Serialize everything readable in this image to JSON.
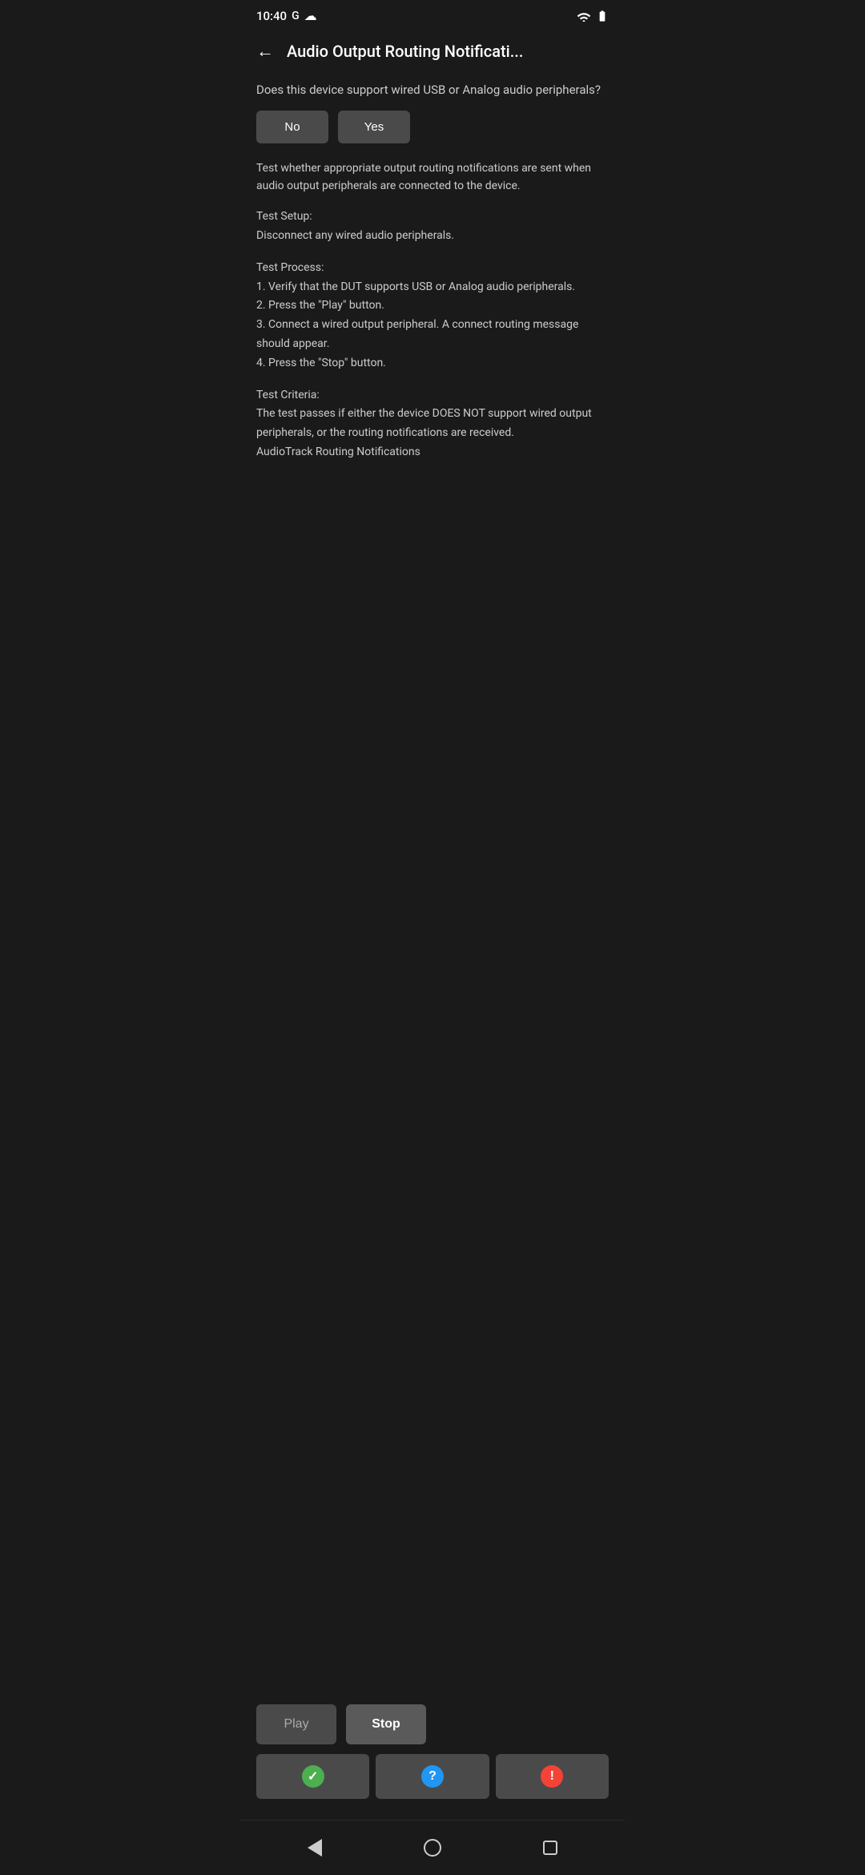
{
  "statusBar": {
    "time": "10:40",
    "googleIcon": "G",
    "cloudIcon": "☁",
    "wifiIcon": "▾",
    "batteryIcon": "🔋"
  },
  "header": {
    "backLabel": "←",
    "title": "Audio Output Routing Notificati..."
  },
  "content": {
    "questionText": "Does this device support wired USB or Analog audio peripherals?",
    "noButton": "No",
    "yesButton": "Yes",
    "descriptionText": "Test whether appropriate output routing notifications are sent when audio output peripherals are connected to the device.",
    "testSetupLabel": "Test Setup:",
    "testSetupDetail": "Disconnect any wired audio peripherals.",
    "testProcessLabel": "Test Process:",
    "testProcessStep1": "1. Verify that the DUT supports USB or Analog audio peripherals.",
    "testProcessStep2": "2. Press the \"Play\" button.",
    "testProcessStep3": "3. Connect a wired output peripheral. A connect routing message should appear.",
    "testProcessStep4": "4. Press the \"Stop\" button.",
    "testCriteriaLabel": "Test Criteria:",
    "testCriteriaText": "The test passes if either the device DOES NOT support wired output peripherals, or the routing notifications are received.",
    "audioTrackLabel": "AudioTrack Routing Notifications"
  },
  "actionArea": {
    "playButton": "Play",
    "stopButton": "Stop",
    "passIcon": "✓",
    "infoIcon": "?",
    "failIcon": "!"
  },
  "navBar": {
    "backTitle": "back-navigation",
    "homeTitle": "home-navigation",
    "recentsTitle": "recents-navigation"
  }
}
